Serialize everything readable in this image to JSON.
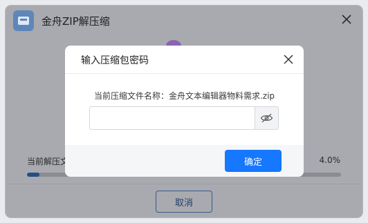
{
  "app": {
    "title": "金舟ZIP解压缩",
    "icon": "zip-folder-icon",
    "close_icon": "close-icon"
  },
  "progress": {
    "label": "当前解压文",
    "percent_text": "4.0%",
    "value": 0.04
  },
  "footer": {
    "cancel_label": "取消"
  },
  "dialog": {
    "title": "输入压缩包密码",
    "file_line": "当前压缩文件名称：金舟文本编辑器物料需求.zip",
    "password_value": "",
    "password_placeholder": "",
    "toggle_icon": "eye-off-icon",
    "ok_label": "确定"
  },
  "colors": {
    "accent": "#1677ff",
    "overlay_bg": "#a8aab0",
    "progress_fill": "#244e86"
  }
}
